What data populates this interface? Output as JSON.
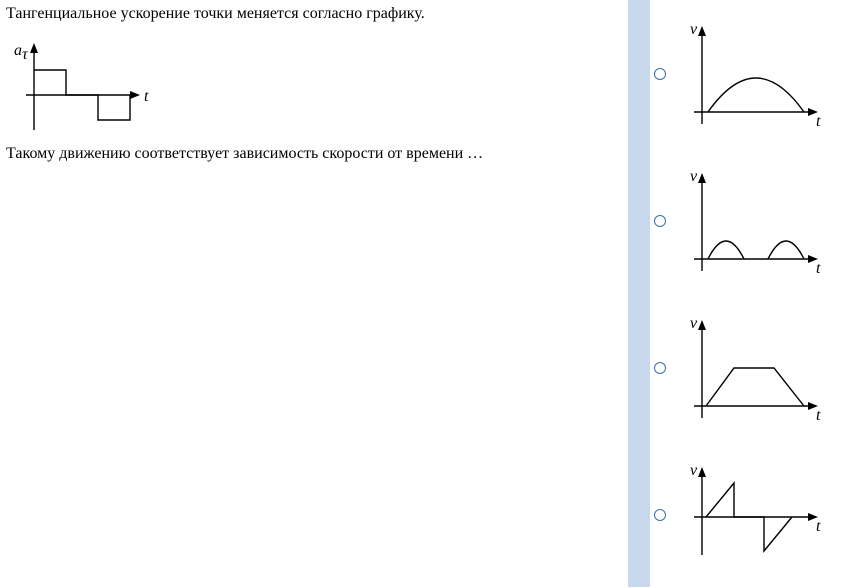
{
  "question": {
    "line1": "Тангенциальное ускорение точки меняется согласно графику.",
    "line2": "Такому движению соответствует зависимость скорости от времени …",
    "graph": {
      "y_label": "a",
      "y_sub": "τ",
      "x_label": "t"
    }
  },
  "options": [
    {
      "id": "opt1",
      "y_label": "v",
      "x_label": "t",
      "shape": "dome"
    },
    {
      "id": "opt2",
      "y_label": "v",
      "x_label": "t",
      "shape": "two-humps"
    },
    {
      "id": "opt3",
      "y_label": "v",
      "x_label": "t",
      "shape": "trapezoid"
    },
    {
      "id": "opt4",
      "y_label": "v",
      "x_label": "t",
      "shape": "sawtooth"
    }
  ],
  "chart_data": [
    {
      "type": "line",
      "title": "question-acceleration-step",
      "xlabel": "t",
      "ylabel": "a_tau",
      "x": [
        0,
        1,
        1,
        2,
        2,
        3,
        3
      ],
      "y": [
        1,
        1,
        0,
        0,
        -1,
        -1,
        0
      ],
      "note": "step: +const on [0,1], 0 on [1,2], -const on [2,3]"
    },
    {
      "type": "line",
      "title": "option-1-dome",
      "xlabel": "t",
      "ylabel": "v",
      "x": [
        0,
        1,
        2,
        3
      ],
      "y": [
        0,
        1,
        1,
        0
      ],
      "note": "single smooth arc starting and ending at 0"
    },
    {
      "type": "line",
      "title": "option-2-two-humps",
      "xlabel": "t",
      "ylabel": "v",
      "x": [
        0,
        0.5,
        1,
        1.5,
        2,
        2.5,
        3
      ],
      "y": [
        0,
        1,
        0,
        0,
        0,
        1,
        0
      ],
      "note": "two separated humps with gap of zero between them"
    },
    {
      "type": "line",
      "title": "option-3-trapezoid",
      "xlabel": "t",
      "ylabel": "v",
      "x": [
        0,
        1,
        2,
        3
      ],
      "y": [
        0,
        1,
        1,
        0
      ],
      "note": "linear rise, plateau, linear fall (piecewise-linear trapezoid)"
    },
    {
      "type": "line",
      "title": "option-4-sawtooth",
      "xlabel": "t",
      "ylabel": "v",
      "x": [
        0,
        1,
        1,
        2,
        2,
        3
      ],
      "y": [
        0,
        1,
        0,
        0,
        -1,
        0
      ],
      "note": "triangle up then drop to 0, flat, drop to -1 then ramp back to 0"
    }
  ]
}
